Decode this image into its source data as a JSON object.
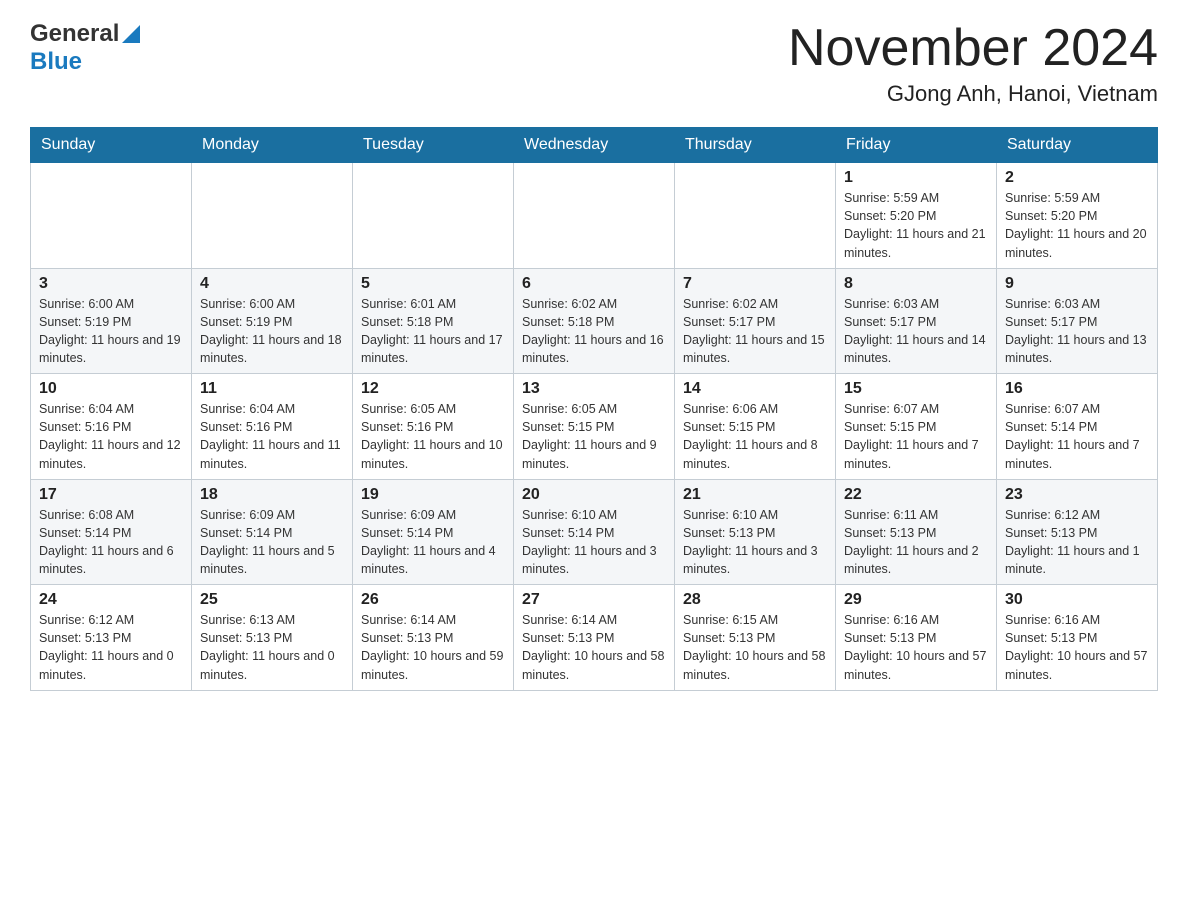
{
  "header": {
    "logo_general": "General",
    "logo_blue": "Blue",
    "title": "November 2024",
    "subtitle": "GJong Anh, Hanoi, Vietnam"
  },
  "days_of_week": [
    "Sunday",
    "Monday",
    "Tuesday",
    "Wednesday",
    "Thursday",
    "Friday",
    "Saturday"
  ],
  "weeks": [
    [
      {
        "day": "",
        "info": ""
      },
      {
        "day": "",
        "info": ""
      },
      {
        "day": "",
        "info": ""
      },
      {
        "day": "",
        "info": ""
      },
      {
        "day": "",
        "info": ""
      },
      {
        "day": "1",
        "info": "Sunrise: 5:59 AM\nSunset: 5:20 PM\nDaylight: 11 hours and 21 minutes."
      },
      {
        "day": "2",
        "info": "Sunrise: 5:59 AM\nSunset: 5:20 PM\nDaylight: 11 hours and 20 minutes."
      }
    ],
    [
      {
        "day": "3",
        "info": "Sunrise: 6:00 AM\nSunset: 5:19 PM\nDaylight: 11 hours and 19 minutes."
      },
      {
        "day": "4",
        "info": "Sunrise: 6:00 AM\nSunset: 5:19 PM\nDaylight: 11 hours and 18 minutes."
      },
      {
        "day": "5",
        "info": "Sunrise: 6:01 AM\nSunset: 5:18 PM\nDaylight: 11 hours and 17 minutes."
      },
      {
        "day": "6",
        "info": "Sunrise: 6:02 AM\nSunset: 5:18 PM\nDaylight: 11 hours and 16 minutes."
      },
      {
        "day": "7",
        "info": "Sunrise: 6:02 AM\nSunset: 5:17 PM\nDaylight: 11 hours and 15 minutes."
      },
      {
        "day": "8",
        "info": "Sunrise: 6:03 AM\nSunset: 5:17 PM\nDaylight: 11 hours and 14 minutes."
      },
      {
        "day": "9",
        "info": "Sunrise: 6:03 AM\nSunset: 5:17 PM\nDaylight: 11 hours and 13 minutes."
      }
    ],
    [
      {
        "day": "10",
        "info": "Sunrise: 6:04 AM\nSunset: 5:16 PM\nDaylight: 11 hours and 12 minutes."
      },
      {
        "day": "11",
        "info": "Sunrise: 6:04 AM\nSunset: 5:16 PM\nDaylight: 11 hours and 11 minutes."
      },
      {
        "day": "12",
        "info": "Sunrise: 6:05 AM\nSunset: 5:16 PM\nDaylight: 11 hours and 10 minutes."
      },
      {
        "day": "13",
        "info": "Sunrise: 6:05 AM\nSunset: 5:15 PM\nDaylight: 11 hours and 9 minutes."
      },
      {
        "day": "14",
        "info": "Sunrise: 6:06 AM\nSunset: 5:15 PM\nDaylight: 11 hours and 8 minutes."
      },
      {
        "day": "15",
        "info": "Sunrise: 6:07 AM\nSunset: 5:15 PM\nDaylight: 11 hours and 7 minutes."
      },
      {
        "day": "16",
        "info": "Sunrise: 6:07 AM\nSunset: 5:14 PM\nDaylight: 11 hours and 7 minutes."
      }
    ],
    [
      {
        "day": "17",
        "info": "Sunrise: 6:08 AM\nSunset: 5:14 PM\nDaylight: 11 hours and 6 minutes."
      },
      {
        "day": "18",
        "info": "Sunrise: 6:09 AM\nSunset: 5:14 PM\nDaylight: 11 hours and 5 minutes."
      },
      {
        "day": "19",
        "info": "Sunrise: 6:09 AM\nSunset: 5:14 PM\nDaylight: 11 hours and 4 minutes."
      },
      {
        "day": "20",
        "info": "Sunrise: 6:10 AM\nSunset: 5:14 PM\nDaylight: 11 hours and 3 minutes."
      },
      {
        "day": "21",
        "info": "Sunrise: 6:10 AM\nSunset: 5:13 PM\nDaylight: 11 hours and 3 minutes."
      },
      {
        "day": "22",
        "info": "Sunrise: 6:11 AM\nSunset: 5:13 PM\nDaylight: 11 hours and 2 minutes."
      },
      {
        "day": "23",
        "info": "Sunrise: 6:12 AM\nSunset: 5:13 PM\nDaylight: 11 hours and 1 minute."
      }
    ],
    [
      {
        "day": "24",
        "info": "Sunrise: 6:12 AM\nSunset: 5:13 PM\nDaylight: 11 hours and 0 minutes."
      },
      {
        "day": "25",
        "info": "Sunrise: 6:13 AM\nSunset: 5:13 PM\nDaylight: 11 hours and 0 minutes."
      },
      {
        "day": "26",
        "info": "Sunrise: 6:14 AM\nSunset: 5:13 PM\nDaylight: 10 hours and 59 minutes."
      },
      {
        "day": "27",
        "info": "Sunrise: 6:14 AM\nSunset: 5:13 PM\nDaylight: 10 hours and 58 minutes."
      },
      {
        "day": "28",
        "info": "Sunrise: 6:15 AM\nSunset: 5:13 PM\nDaylight: 10 hours and 58 minutes."
      },
      {
        "day": "29",
        "info": "Sunrise: 6:16 AM\nSunset: 5:13 PM\nDaylight: 10 hours and 57 minutes."
      },
      {
        "day": "30",
        "info": "Sunrise: 6:16 AM\nSunset: 5:13 PM\nDaylight: 10 hours and 57 minutes."
      }
    ]
  ]
}
